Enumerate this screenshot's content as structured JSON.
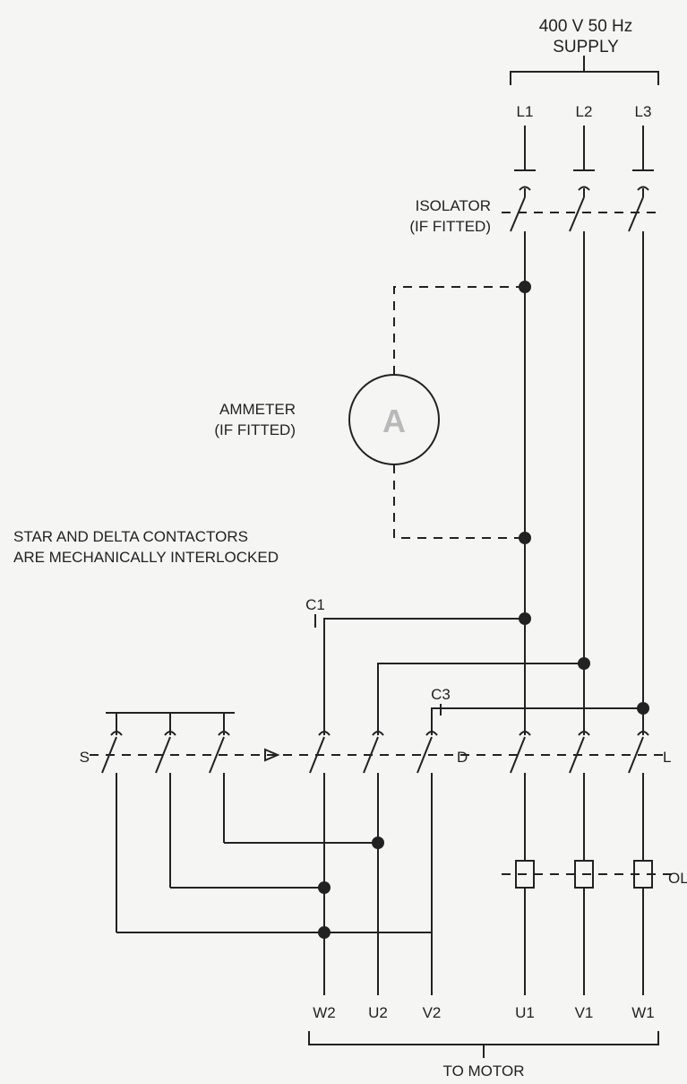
{
  "diagram": {
    "title_line1": "400 V 50 Hz",
    "title_line2": "SUPPLY",
    "phase_labels": {
      "L1": "L1",
      "L2": "L2",
      "L3": "L3"
    },
    "isolator_line1": "ISOLATOR",
    "isolator_line2": "(IF FITTED)",
    "ammeter_line1": "AMMETER",
    "ammeter_line2": "(IF FITTED)",
    "ammeter_symbol": "A",
    "interlock_line1": "STAR AND DELTA CONTACTORS",
    "interlock_line2": "ARE MECHANICALLY INTERLOCKED",
    "contactor_labels": {
      "S": "S",
      "D": "D",
      "L": "L"
    },
    "aux_labels": {
      "C1": "C1",
      "C3": "C3"
    },
    "overload_label": "OL",
    "motor_terminals": {
      "W2": "W2",
      "U2": "U2",
      "V2": "V2",
      "U1": "U1",
      "V1": "V1",
      "W1": "W1"
    },
    "motor_text": "TO MOTOR"
  },
  "chart_data": {
    "type": "schematic",
    "description": "Star-delta motor starter power circuit",
    "supply": {
      "voltage_V": 400,
      "frequency_Hz": 50,
      "phases": [
        "L1",
        "L2",
        "L3"
      ]
    },
    "components": [
      {
        "id": "isolator",
        "type": "3-pole isolator switch",
        "optional": true,
        "between": [
          "supply L1-L3",
          "bus L1-L3"
        ]
      },
      {
        "id": "ammeter",
        "type": "ammeter",
        "optional": true,
        "in_line_with": "L1"
      },
      {
        "id": "L",
        "type": "main (line) contactor",
        "poles": 3,
        "from": [
          "L1",
          "L2",
          "L3"
        ],
        "to_motor": [
          "U1",
          "V1",
          "W1"
        ],
        "via_overload": true
      },
      {
        "id": "OL",
        "type": "thermal overload relay",
        "poles": 3,
        "in_series_with": "L contactor output",
        "to_motor": [
          "U1",
          "V1",
          "W1"
        ]
      },
      {
        "id": "D",
        "type": "delta contactor",
        "poles": 3,
        "from_bus": [
          "L1_via_C1",
          "L2",
          "L3_via_C3"
        ],
        "to_motor": [
          "W2",
          "U2",
          "V2"
        ]
      },
      {
        "id": "S",
        "type": "star contactor",
        "poles": 3,
        "function": "short W2-U2-V2 together (star point)",
        "wiring": "tops of 3 S poles bridged; bottoms feed W2,U2,V2 bus"
      }
    ],
    "mechanical_interlock": [
      "S",
      "D"
    ],
    "motor_terminals_group_A": [
      "W2",
      "U2",
      "V2"
    ],
    "motor_terminals_group_B": [
      "U1",
      "V1",
      "W1"
    ]
  }
}
